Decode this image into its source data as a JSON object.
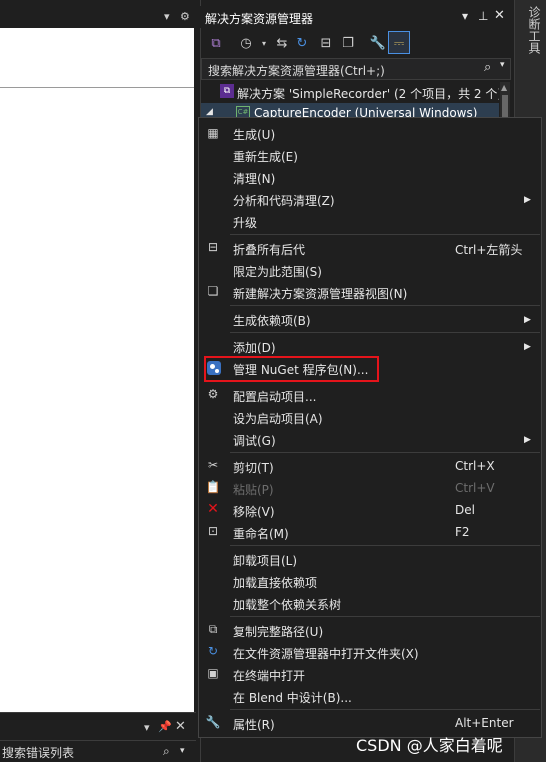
{
  "left_area": {
    "error_list_search": "搜索错误列表"
  },
  "solution_explorer": {
    "title": "解决方案资源管理器",
    "search_placeholder": "搜索解决方案资源管理器(Ctrl+;)",
    "solution_label": "解决方案 'SimpleRecorder' (2 个项目，共 2 个)",
    "project_label": "CaptureEncoder (Universal Windows)"
  },
  "right_strip": {
    "diagnostics_tab": "诊断工具"
  },
  "context_menu": {
    "build": "生成(U)",
    "rebuild": "重新生成(E)",
    "clean": "清理(N)",
    "analyze": "分析和代码清理(Z)",
    "upgrade": "升级",
    "collapse_all": "折叠所有后代",
    "collapse_all_shortcut": "Ctrl+左箭头",
    "scope_to_this": "限定为此范围(S)",
    "new_view": "新建解决方案资源管理器视图(N)",
    "build_dependencies": "生成依赖项(B)",
    "add": "添加(D)",
    "manage_nuget": "管理 NuGet 程序包(N)...",
    "configure_startup": "配置启动项目...",
    "set_as_startup": "设为启动项目(A)",
    "debug": "调试(G)",
    "cut": "剪切(T)",
    "cut_shortcut": "Ctrl+X",
    "paste": "粘贴(P)",
    "paste_shortcut": "Ctrl+V",
    "remove": "移除(V)",
    "remove_shortcut": "Del",
    "rename": "重命名(M)",
    "rename_shortcut": "F2",
    "unload_project": "卸载项目(L)",
    "load_direct_deps": "加载直接依赖项",
    "load_entire_tree": "加载整个依赖关系树",
    "copy_full_path": "复制完整路径(U)",
    "open_in_explorer": "在文件资源管理器中打开文件夹(X)",
    "open_in_terminal": "在终端中打开",
    "design_in_blend": "在 Blend 中设计(B)...",
    "properties": "属性(R)",
    "properties_shortcut": "Alt+Enter"
  },
  "watermark": "CSDN @人家白着呢",
  "colors": {
    "highlight_border": "#e5141b",
    "menu_bg": "#1f1f1f",
    "selected_row": "#2d3e50",
    "nuget_blue": "#3a71c1"
  }
}
